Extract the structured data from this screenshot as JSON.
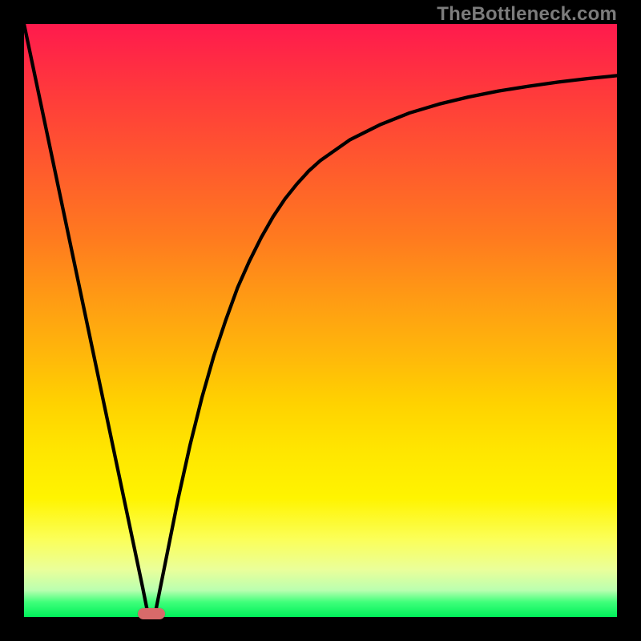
{
  "attribution": "TheBottleneck.com",
  "colors": {
    "frame": "#000000",
    "gradient_top": "#ff1a4d",
    "gradient_bottom": "#00f05a",
    "curve": "#000000",
    "marker": "#d86a6a",
    "attribution_text": "#7c7c7c"
  },
  "chart_data": {
    "type": "line",
    "title": "",
    "xlabel": "",
    "ylabel": "",
    "xlim": [
      0,
      100
    ],
    "ylim": [
      0,
      100
    ],
    "grid": false,
    "legend": false,
    "x": [
      0,
      2,
      4,
      6,
      8,
      10,
      12,
      14,
      16,
      18,
      20,
      21,
      22,
      23,
      24,
      26,
      28,
      30,
      32,
      34,
      36,
      38,
      40,
      42,
      44,
      46,
      48,
      50,
      55,
      60,
      65,
      70,
      75,
      80,
      85,
      90,
      95,
      100
    ],
    "y": [
      100,
      90.5,
      81,
      71.5,
      62,
      52.5,
      43,
      33.5,
      24,
      14.5,
      5,
      0,
      0,
      5,
      10,
      20,
      29,
      37,
      44,
      50,
      55.5,
      60,
      64,
      67.5,
      70.5,
      73,
      75.2,
      77,
      80.5,
      83,
      85,
      86.5,
      87.7,
      88.7,
      89.5,
      90.2,
      90.8,
      91.3
    ],
    "annotations": [
      {
        "type": "marker",
        "x": 21.5,
        "y": 0.5,
        "shape": "pill",
        "color": "#d86a6a"
      }
    ],
    "notes": "x and y are in percent of plot area; y=0 at bottom, y=100 at top. Curve descends linearly from top-left to a minimum near x≈21 then asymptotically rises toward ~91 at right edge."
  }
}
